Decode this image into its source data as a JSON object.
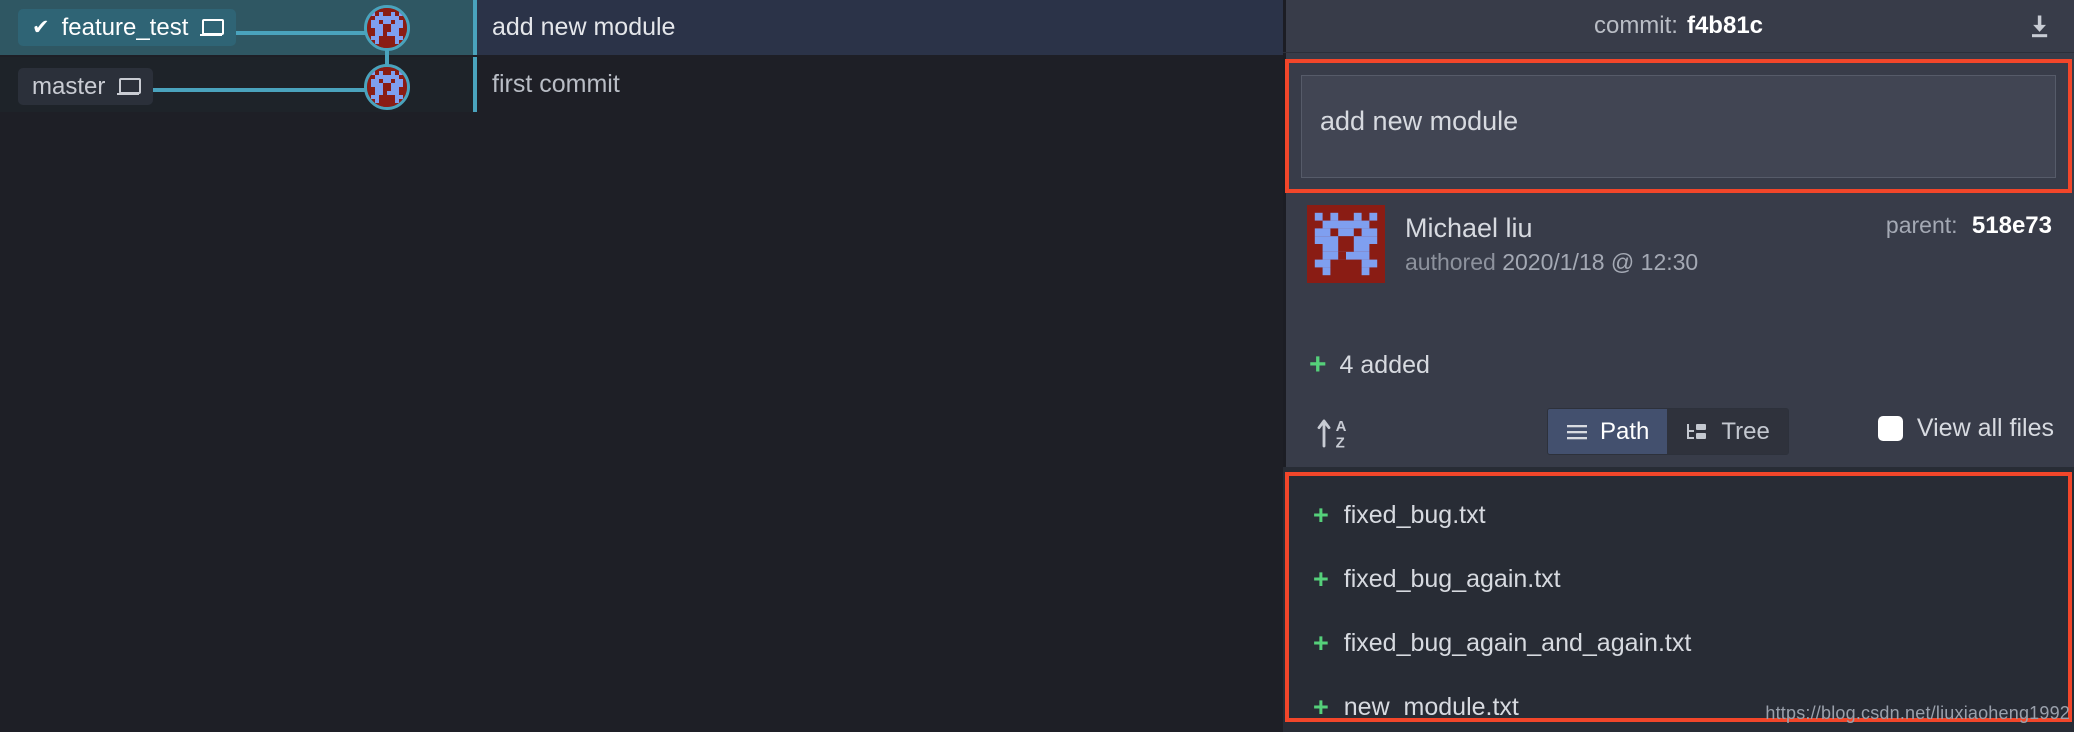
{
  "graph": {
    "branches": [
      {
        "name": "feature_test",
        "is_current": true,
        "check_icon": "check-icon",
        "location_icon": "laptop-icon"
      },
      {
        "name": "master",
        "is_current": false,
        "location_icon": "laptop-icon"
      }
    ],
    "commits": [
      {
        "message": "add new module",
        "selected": true
      },
      {
        "message": "first commit",
        "selected": false
      }
    ],
    "line_color": "#4aa3bd",
    "selected_row_color": "#2b3348"
  },
  "detail": {
    "header": {
      "label": "commit:",
      "hash": "f4b81c",
      "download_icon": "download-icon"
    },
    "message": "add new module",
    "author": {
      "name": "Michael liu",
      "authored_word": "authored",
      "date": "2020/1/18 @ 12:30",
      "avatar_icon": "avatar-invader-icon"
    },
    "parent": {
      "label": "parent:",
      "hash": "518e73"
    },
    "summary": {
      "plus_icon": "plus-icon",
      "text": "4 added"
    },
    "toolbar": {
      "sort_icon": "sort-alpha-asc-icon",
      "path_label": "Path",
      "path_icon": "list-lines-icon",
      "tree_label": "Tree",
      "tree_icon": "tree-folder-icon",
      "view_all_label": "View all files",
      "view_all_checked": false,
      "active_segment": "Path"
    },
    "files": [
      {
        "status": "+",
        "name": "fixed_bug.txt"
      },
      {
        "status": "+",
        "name": "fixed_bug_again.txt"
      },
      {
        "status": "+",
        "name": "fixed_bug_again_and_again.txt"
      },
      {
        "status": "+",
        "name": "new_module.txt"
      }
    ]
  },
  "highlight_color": "#f2462a",
  "watermark": "https://blog.csdn.net/liuxiaoheng1992"
}
